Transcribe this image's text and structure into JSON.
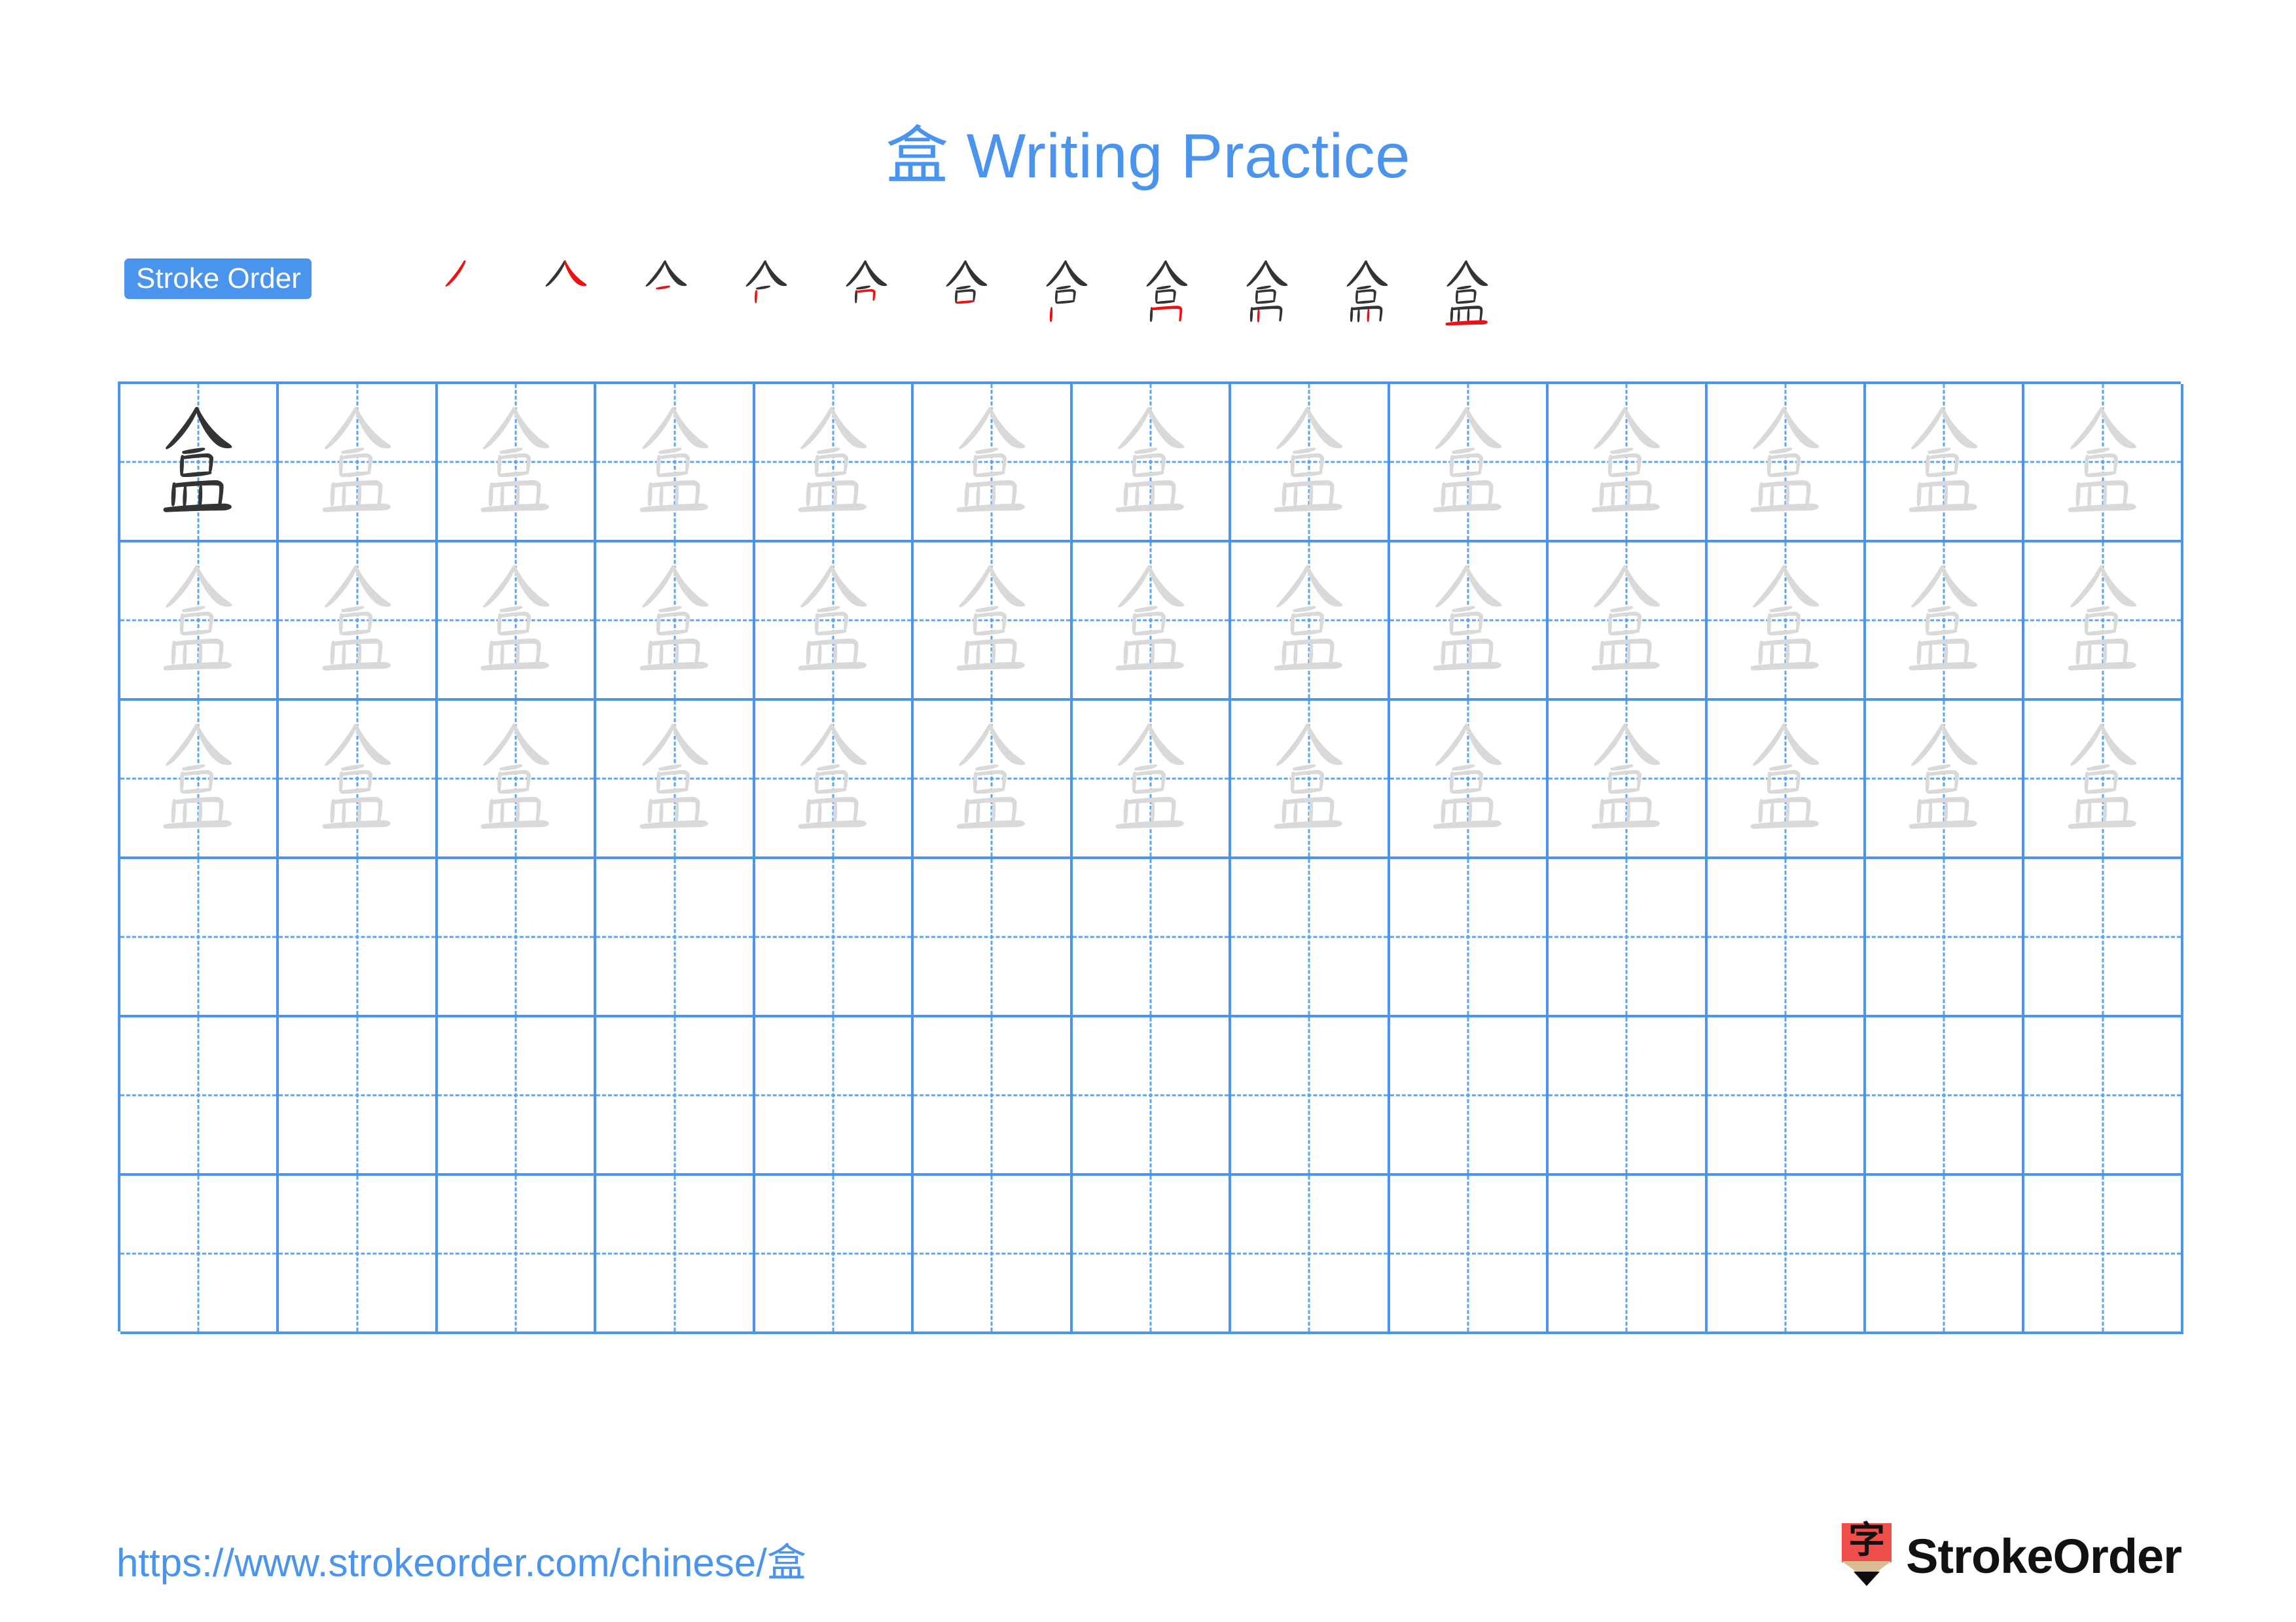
{
  "page": {
    "background": "#ffffff",
    "accent_blue": "#4a94ee",
    "grid_line_color": "#4a94ee",
    "trace_gray": "#d9d9d9",
    "ink_black": "#333333",
    "highlight_red": "#ee1111"
  },
  "title": {
    "character": "盒",
    "text": " Writing Practice",
    "full": "盒 Writing Practice"
  },
  "stroke_order": {
    "badge_label": "Stroke Order",
    "character": "盒",
    "total_strokes": 11,
    "stages": [
      {
        "index": 1,
        "strokes_shown": 1,
        "new_stroke_name": "pie"
      },
      {
        "index": 2,
        "strokes_shown": 2,
        "new_stroke_name": "na"
      },
      {
        "index": 3,
        "strokes_shown": 3,
        "new_stroke_name": "heng"
      },
      {
        "index": 4,
        "strokes_shown": 4,
        "new_stroke_name": "shu"
      },
      {
        "index": 5,
        "strokes_shown": 5,
        "new_stroke_name": "heng-zhe"
      },
      {
        "index": 6,
        "strokes_shown": 6,
        "new_stroke_name": "heng"
      },
      {
        "index": 7,
        "strokes_shown": 7,
        "new_stroke_name": "shu"
      },
      {
        "index": 8,
        "strokes_shown": 8,
        "new_stroke_name": "heng-zhe"
      },
      {
        "index": 9,
        "strokes_shown": 9,
        "new_stroke_name": "shu"
      },
      {
        "index": 10,
        "strokes_shown": 10,
        "new_stroke_name": "shu"
      },
      {
        "index": 11,
        "strokes_shown": 11,
        "new_stroke_name": "heng"
      }
    ]
  },
  "practice_grid": {
    "columns": 13,
    "rows": 6,
    "rows_data": [
      {
        "row": 1,
        "cells": [
          "ink",
          "trace",
          "trace",
          "trace",
          "trace",
          "trace",
          "trace",
          "trace",
          "trace",
          "trace",
          "trace",
          "trace",
          "trace"
        ]
      },
      {
        "row": 2,
        "cells": [
          "trace",
          "trace",
          "trace",
          "trace",
          "trace",
          "trace",
          "trace",
          "trace",
          "trace",
          "trace",
          "trace",
          "trace",
          "trace"
        ]
      },
      {
        "row": 3,
        "cells": [
          "trace",
          "trace",
          "trace",
          "trace",
          "trace",
          "trace",
          "trace",
          "trace",
          "trace",
          "trace",
          "trace",
          "trace",
          "trace"
        ]
      },
      {
        "row": 4,
        "cells": [
          "empty",
          "empty",
          "empty",
          "empty",
          "empty",
          "empty",
          "empty",
          "empty",
          "empty",
          "empty",
          "empty",
          "empty",
          "empty"
        ]
      },
      {
        "row": 5,
        "cells": [
          "empty",
          "empty",
          "empty",
          "empty",
          "empty",
          "empty",
          "empty",
          "empty",
          "empty",
          "empty",
          "empty",
          "empty",
          "empty"
        ]
      },
      {
        "row": 6,
        "cells": [
          "empty",
          "empty",
          "empty",
          "empty",
          "empty",
          "empty",
          "empty",
          "empty",
          "empty",
          "empty",
          "empty",
          "empty",
          "empty"
        ]
      }
    ],
    "character": "盒"
  },
  "footer": {
    "url": "https://www.strokeorder.com/chinese/盒",
    "brand_name": "StrokeOrder",
    "logo_glyph": "字",
    "logo_body_color": "#f04e4a",
    "logo_wood_color": "#dcbc92",
    "logo_tip_color": "#0d0d0d"
  }
}
